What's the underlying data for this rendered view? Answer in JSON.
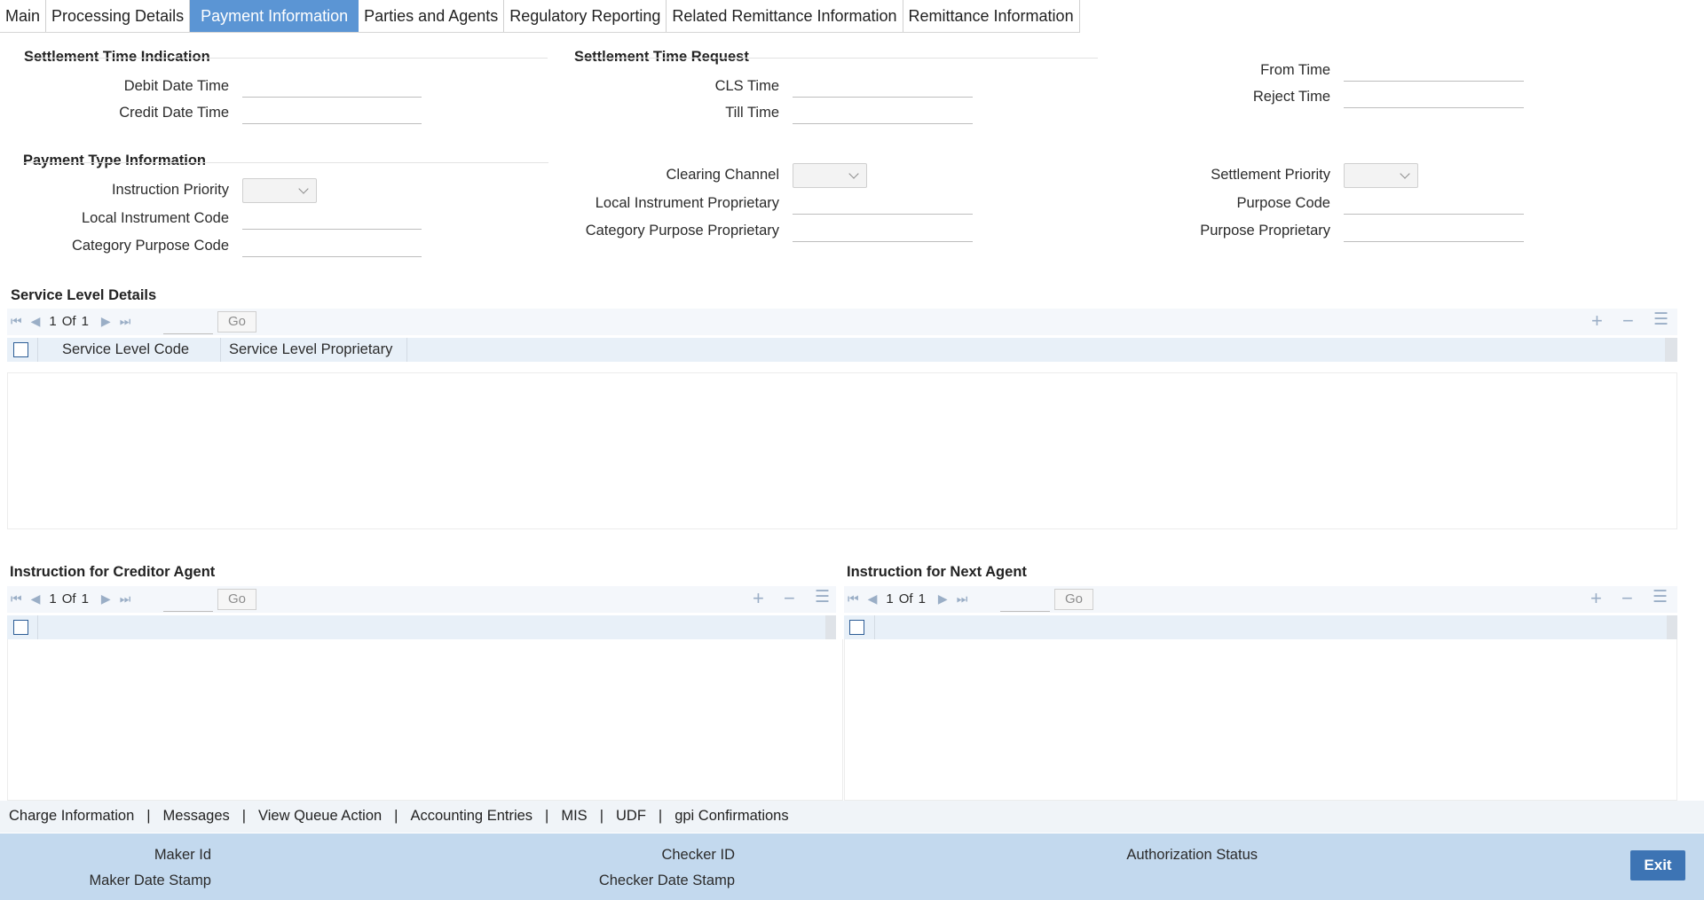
{
  "tabs": [
    "Main",
    "Processing Details",
    "Payment Information",
    "Parties and Agents",
    "Regulatory Reporting",
    "Related Remittance Information",
    "Remittance Information"
  ],
  "active_tab": "Payment Information",
  "settlement_time_indication": {
    "title": "Settlement Time Indication",
    "debit_date_time": "Debit Date Time",
    "credit_date_time": "Credit Date Time"
  },
  "settlement_time_request": {
    "title": "Settlement Time Request",
    "cls_time": "CLS Time",
    "till_time": "Till Time",
    "from_time": "From Time",
    "reject_time": "Reject Time"
  },
  "payment_type_information": {
    "title": "Payment Type Information",
    "instruction_priority": "Instruction Priority",
    "local_instrument_code": "Local Instrument Code",
    "category_purpose_code": "Category Purpose Code",
    "clearing_channel": "Clearing Channel",
    "local_instrument_proprietary": "Local Instrument Proprietary",
    "category_purpose_proprietary": "Category Purpose Proprietary",
    "settlement_priority": "Settlement Priority",
    "purpose_code": "Purpose Code",
    "purpose_proprietary": "Purpose Proprietary"
  },
  "service_level_details": {
    "title": "Service Level Details",
    "page": "1",
    "of_label": "Of",
    "total": "1",
    "go": "Go",
    "columns": [
      "Service Level Code",
      "Service Level Proprietary"
    ]
  },
  "creditor_agent": {
    "title": "Instruction for Creditor Agent",
    "page": "1",
    "of_label": "Of",
    "total": "1",
    "go": "Go"
  },
  "next_agent": {
    "title": "Instruction for Next Agent",
    "page": "1",
    "of_label": "Of",
    "total": "1",
    "go": "Go"
  },
  "footer_links": [
    "Charge Information",
    "Messages",
    "View Queue Action",
    "Accounting Entries",
    "MIS",
    "UDF",
    "gpi Confirmations"
  ],
  "footer": {
    "maker_id": "Maker Id",
    "maker_date_stamp": "Maker Date Stamp",
    "checker_id": "Checker ID",
    "checker_date_stamp": "Checker Date Stamp",
    "authorization_status": "Authorization Status",
    "exit": "Exit"
  },
  "colors": {
    "active_tab": "#5b95d4",
    "footer_bg": "#c3d9ee",
    "exit_button": "#3d74b4"
  }
}
